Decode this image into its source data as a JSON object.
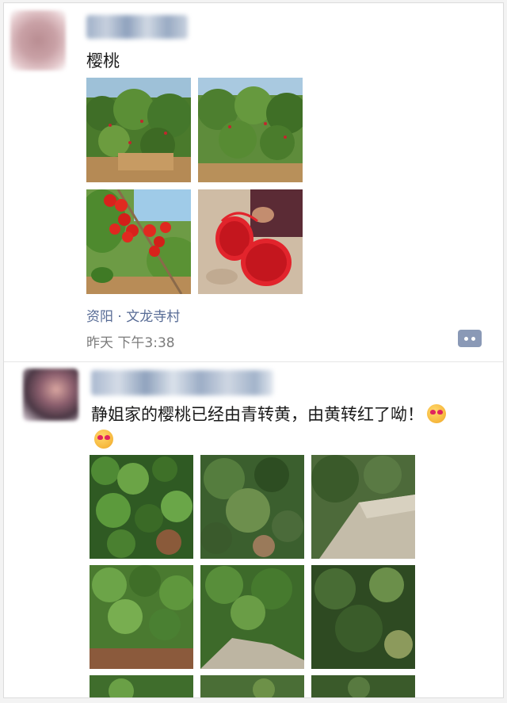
{
  "post1": {
    "text": "樱桃",
    "location": "资阳 · 文龙寺村",
    "time": "昨天 下午3:38",
    "images": [
      "cherry-orchard-1",
      "cherry-orchard-2",
      "cherry-branch",
      "cherry-baskets"
    ]
  },
  "post2": {
    "text": "静姐家的樱桃已经由青转黄，由黄转红了呦！",
    "emojis": [
      "heart-eyes-emoji",
      "heart-eyes-emoji"
    ],
    "images": [
      "leaves-1",
      "leaves-2",
      "stone-wall",
      "leaves-3",
      "leaves-4",
      "leaves-5",
      "leaves-6",
      "leaves-7",
      "leaves-8"
    ]
  },
  "colors": {
    "link": "#576b95",
    "time": "#7b7b7b",
    "comment_button": "#8a99b6"
  },
  "icons": {
    "comment": "comment-dots-icon"
  }
}
